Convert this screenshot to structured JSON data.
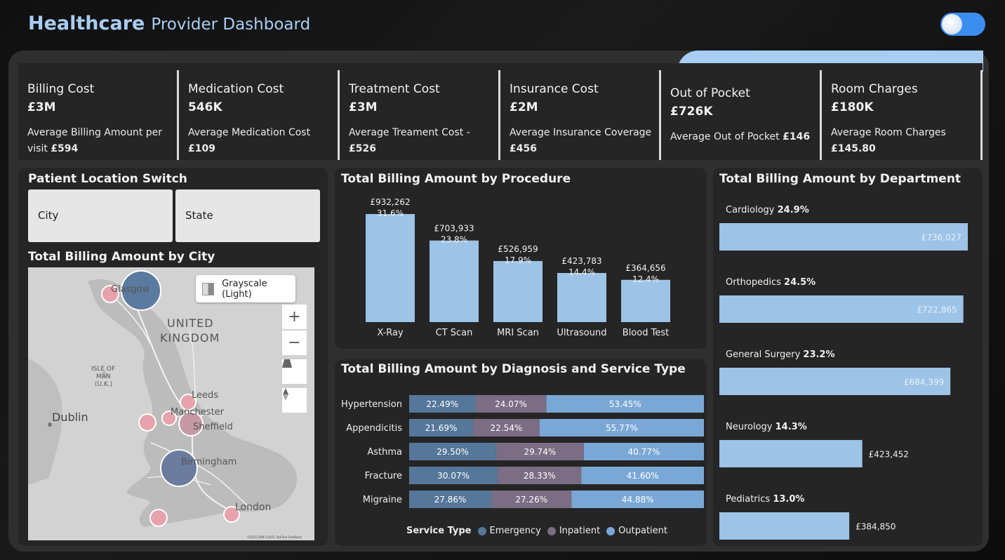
{
  "header": {
    "title_bold": "Healthcare",
    "title_light": "Provider Dashboard"
  },
  "kpis": [
    {
      "label": "Billing Cost",
      "value": "£3M",
      "sub": "Average Billing Amount per visit",
      "sub_value": "£594"
    },
    {
      "label": "Medication Cost",
      "value": "546K",
      "sub": "Average Medication Cost",
      "sub_value": "£109"
    },
    {
      "label": "Treatment Cost",
      "value": "£3M",
      "sub": "Average Treament Cost -",
      "sub_value": "£526"
    },
    {
      "label": "Insurance Cost",
      "value": "£2M",
      "sub": "Average Insurance Coverage",
      "sub_value": "£456"
    },
    {
      "label": "Out of Pocket",
      "value": "£726K",
      "sub": "Average Out of Pocket",
      "sub_value": "£146"
    },
    {
      "label": "Room Charges",
      "value": "£180K",
      "sub": "Average Room Charges",
      "sub_value": "£145.80"
    }
  ],
  "location_switch": {
    "title": "Patient Location Switch",
    "city": "City",
    "state": "State"
  },
  "map": {
    "title": "Total Billing Amount by City",
    "style_label": "Grayscale (Light)",
    "country": [
      "UNITED",
      "KINGDOM"
    ],
    "isle": [
      "ISLE OF",
      "MAN",
      "(U.K.)"
    ],
    "cities": [
      "Glasgow",
      "Dublin",
      "Leeds",
      "Manchester",
      "Sheffield",
      "Birmingham",
      "London"
    ],
    "zoom_in": "+",
    "zoom_out": "−",
    "attribution": "©2025 OSM ©2021 TomTom Feedback",
    "bubble_color_large": "#5b7aa0",
    "bubble_color_small": "#e8a2ac"
  },
  "procedure_chart": {
    "title": "Total Billing Amount by Procedure"
  },
  "diagnosis_chart": {
    "title": "Total Billing Amount by Diagnosis and Service Type",
    "legend_title": "Service Type",
    "legend": [
      "Emergency",
      "Inpatient",
      "Outpatient"
    ]
  },
  "department_chart": {
    "title": "Total Billing Amount by Department"
  },
  "chart_data": [
    {
      "type": "bar",
      "title": "Total Billing Amount by Procedure",
      "categories": [
        "X-Ray",
        "CT Scan",
        "MRI Scan",
        "Ultrasound",
        "Blood Test"
      ],
      "values": [
        932262,
        703933,
        526959,
        423783,
        364656
      ],
      "value_labels": [
        "£932,262",
        "£703,933",
        "£526,959",
        "£423,783",
        "£364,656"
      ],
      "percent_labels": [
        "31.6%",
        "23.8%",
        "17.9%",
        "14.4%",
        "12.4%"
      ],
      "color": "#9dc3e6",
      "ylim": [
        0,
        932262
      ]
    },
    {
      "type": "bar",
      "orientation": "horizontal",
      "stacked": "100%",
      "title": "Total Billing Amount by Diagnosis and Service Type",
      "categories": [
        "Hypertension",
        "Appendicitis",
        "Asthma",
        "Fracture",
        "Migraine"
      ],
      "series": [
        {
          "name": "Emergency",
          "color": "#557799",
          "values": [
            22.49,
            21.69,
            29.5,
            30.07,
            27.86
          ]
        },
        {
          "name": "Inpatient",
          "color": "#7a6d84",
          "values": [
            24.07,
            22.54,
            29.74,
            28.33,
            27.26
          ]
        },
        {
          "name": "Outpatient",
          "color": "#7aa8d6",
          "values": [
            53.45,
            55.77,
            40.77,
            41.6,
            44.88
          ]
        }
      ],
      "labels": [
        [
          "22.49%",
          "24.07%",
          "53.45%"
        ],
        [
          "21.69%",
          "22.54%",
          "55.77%"
        ],
        [
          "29.50%",
          "29.74%",
          "40.77%"
        ],
        [
          "30.07%",
          "28.33%",
          "41.60%"
        ],
        [
          "27.86%",
          "27.26%",
          "44.88%"
        ]
      ],
      "legend": "bottom"
    },
    {
      "type": "bar",
      "orientation": "horizontal",
      "title": "Total Billing Amount by Department",
      "categories": [
        "Cardiology",
        "Orthopedics",
        "General Surgery",
        "Neurology",
        "Pediatrics"
      ],
      "values": [
        736027,
        722865,
        684399,
        423452,
        384850
      ],
      "value_labels": [
        "£736,027",
        "£722,865",
        "£684,399",
        "£423,452",
        "£384,850"
      ],
      "percent_labels": [
        "24.9%",
        "24.5%",
        "23.2%",
        "14.3%",
        "13.0%"
      ],
      "color": "#9dc3e6",
      "xlim": [
        0,
        736027
      ]
    }
  ]
}
